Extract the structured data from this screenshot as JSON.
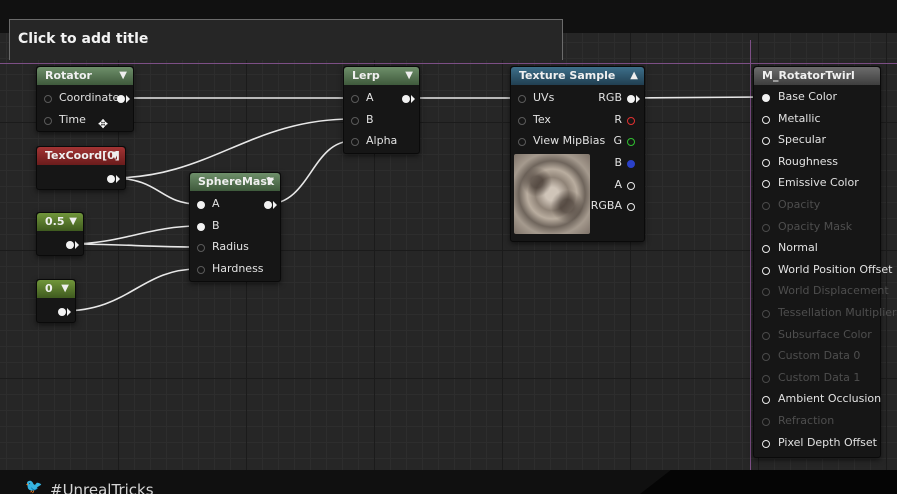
{
  "editor": {
    "title_placeholder": "Click to add title",
    "footer_hashtag": "#UnrealTricks",
    "guide_color": "#7d4f86"
  },
  "nodes": {
    "rotator": {
      "title": "Rotator",
      "inputs": [
        "Coordinate",
        "Time"
      ]
    },
    "texcoord": {
      "title": "TexCoord[0]"
    },
    "const_a": {
      "title": "0.5"
    },
    "const_b": {
      "title": "0"
    },
    "spheremask": {
      "title": "SphereMask",
      "inputs": [
        "A",
        "B",
        "Radius",
        "Hardness"
      ]
    },
    "lerp": {
      "title": "Lerp",
      "inputs": [
        "A",
        "B",
        "Alpha"
      ]
    },
    "texture_sample": {
      "title": "Texture Sample",
      "inputs": [
        "UVs",
        "Tex",
        "View MipBias"
      ],
      "outputs": [
        "RGB",
        "R",
        "G",
        "B",
        "A",
        "RGBA"
      ]
    },
    "material": {
      "title": "M_RotatorTwirl",
      "pins": [
        {
          "label": "Base Color",
          "enabled": true
        },
        {
          "label": "Metallic",
          "enabled": true
        },
        {
          "label": "Specular",
          "enabled": true
        },
        {
          "label": "Roughness",
          "enabled": true
        },
        {
          "label": "Emissive Color",
          "enabled": true
        },
        {
          "label": "Opacity",
          "enabled": false
        },
        {
          "label": "Opacity Mask",
          "enabled": false
        },
        {
          "label": "Normal",
          "enabled": true
        },
        {
          "label": "World Position Offset",
          "enabled": true
        },
        {
          "label": "World Displacement",
          "enabled": false
        },
        {
          "label": "Tessellation Multiplier",
          "enabled": false
        },
        {
          "label": "Subsurface Color",
          "enabled": false
        },
        {
          "label": "Custom Data 0",
          "enabled": false
        },
        {
          "label": "Custom Data 1",
          "enabled": false
        },
        {
          "label": "Ambient Occlusion",
          "enabled": true
        },
        {
          "label": "Refraction",
          "enabled": false
        },
        {
          "label": "Pixel Depth Offset",
          "enabled": true
        }
      ]
    }
  },
  "colors": {
    "header_green": "#4f6e4b",
    "header_red": "#8a2727",
    "header_blue": "#2f5a72",
    "header_grey": "#555555",
    "wire": "#e8e8e8",
    "pin_r": "#e03030",
    "pin_g": "#30c030",
    "pin_b": "#2a40c8"
  },
  "icons": [
    "dropdown-caret-icon",
    "twitter-bird-icon",
    "texture-thumbnail",
    "mouse-cursor-icon"
  ]
}
